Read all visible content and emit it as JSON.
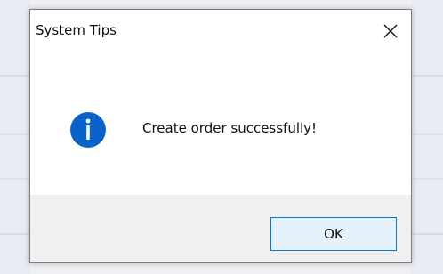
{
  "dialog": {
    "title": "System Tips",
    "message": "Create order successfully!",
    "ok_label": "OK"
  },
  "icons": {
    "close": "close-icon",
    "info": "info-icon"
  },
  "colors": {
    "info_icon": "#0a63c9",
    "ok_button_border": "#0078d7",
    "ok_button_bg": "#e5f1fb",
    "footer_bg": "#f0f0f0"
  }
}
